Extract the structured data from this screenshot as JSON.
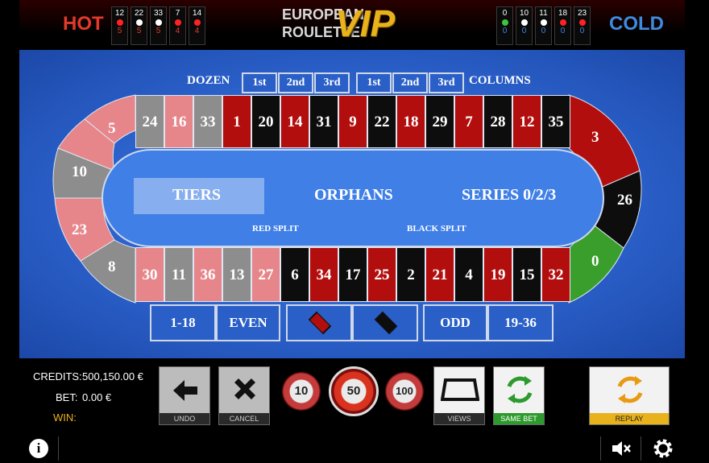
{
  "header": {
    "hot_label": "HOT",
    "cold_label": "COLD",
    "logo_line1": "EUROPEAN",
    "logo_line2": "ROULETTE",
    "logo_vip": "VIP",
    "hot_numbers": [
      {
        "number": "12",
        "count": "5",
        "color": "#ff2222"
      },
      {
        "number": "22",
        "count": "5",
        "color": "#ffffff"
      },
      {
        "number": "33",
        "count": "5",
        "color": "#ffffff"
      },
      {
        "number": "7",
        "count": "4",
        "color": "#ff2222"
      },
      {
        "number": "14",
        "count": "4",
        "color": "#ff2222"
      }
    ],
    "cold_numbers": [
      {
        "number": "0",
        "count": "0",
        "color": "#3ec43e"
      },
      {
        "number": "10",
        "count": "0",
        "color": "#ffffff"
      },
      {
        "number": "11",
        "count": "0",
        "color": "#ffffff"
      },
      {
        "number": "18",
        "count": "0",
        "color": "#ff2222"
      },
      {
        "number": "23",
        "count": "0",
        "color": "#ff2222"
      }
    ]
  },
  "table": {
    "dozen_label": "DOZEN",
    "columns_label": "COLUMNS",
    "dozen_buttons": [
      "1st",
      "2nd",
      "3rd"
    ],
    "column_buttons": [
      "1st",
      "2nd",
      "3rd"
    ],
    "top_row": [
      {
        "n": "24",
        "c": "grey"
      },
      {
        "n": "16",
        "c": "pink"
      },
      {
        "n": "33",
        "c": "grey"
      },
      {
        "n": "1",
        "c": "red"
      },
      {
        "n": "20",
        "c": "black"
      },
      {
        "n": "14",
        "c": "red"
      },
      {
        "n": "31",
        "c": "black"
      },
      {
        "n": "9",
        "c": "red"
      },
      {
        "n": "22",
        "c": "black"
      },
      {
        "n": "18",
        "c": "red"
      },
      {
        "n": "29",
        "c": "black"
      },
      {
        "n": "7",
        "c": "red"
      },
      {
        "n": "28",
        "c": "black"
      },
      {
        "n": "12",
        "c": "red"
      },
      {
        "n": "35",
        "c": "black"
      }
    ],
    "bottom_row": [
      {
        "n": "30",
        "c": "pink"
      },
      {
        "n": "11",
        "c": "grey"
      },
      {
        "n": "36",
        "c": "pink"
      },
      {
        "n": "13",
        "c": "grey"
      },
      {
        "n": "27",
        "c": "pink"
      },
      {
        "n": "6",
        "c": "black"
      },
      {
        "n": "34",
        "c": "red"
      },
      {
        "n": "17",
        "c": "black"
      },
      {
        "n": "25",
        "c": "red"
      },
      {
        "n": "2",
        "c": "black"
      },
      {
        "n": "21",
        "c": "red"
      },
      {
        "n": "4",
        "c": "black"
      },
      {
        "n": "19",
        "c": "red"
      },
      {
        "n": "15",
        "c": "black"
      },
      {
        "n": "32",
        "c": "red"
      }
    ],
    "left_curve": [
      "5",
      "10",
      "23",
      "8"
    ],
    "right_curve": [
      "3",
      "26",
      "0"
    ],
    "tiers": "TIERS",
    "orphans": "ORPHANS",
    "series": "SERIES 0/2/3",
    "red_split": "RED SPLIT",
    "black_split": "BLACK SPLIT",
    "outside_bets": [
      "1-18",
      "EVEN",
      "ODD",
      "19-36"
    ],
    "colors": {
      "red": "#b30e0e",
      "black": "#0d0d0d",
      "pink": "#e6868a",
      "grey": "#8d8d8d",
      "green": "#3a9e2c",
      "felt": "#2a5fc8"
    }
  },
  "footer": {
    "credits_label": "CREDITS:",
    "credits_value": "500,150.00 €",
    "bet_label": "BET:",
    "bet_value": "0.00 €",
    "win_label": "WIN:",
    "undo_label": "UNDO",
    "cancel_label": "CANCEL",
    "chips": [
      "10",
      "50",
      "100"
    ],
    "views_label": "VIEWS",
    "same_bet_label": "SAME BET",
    "replay_label": "REPLAY"
  }
}
